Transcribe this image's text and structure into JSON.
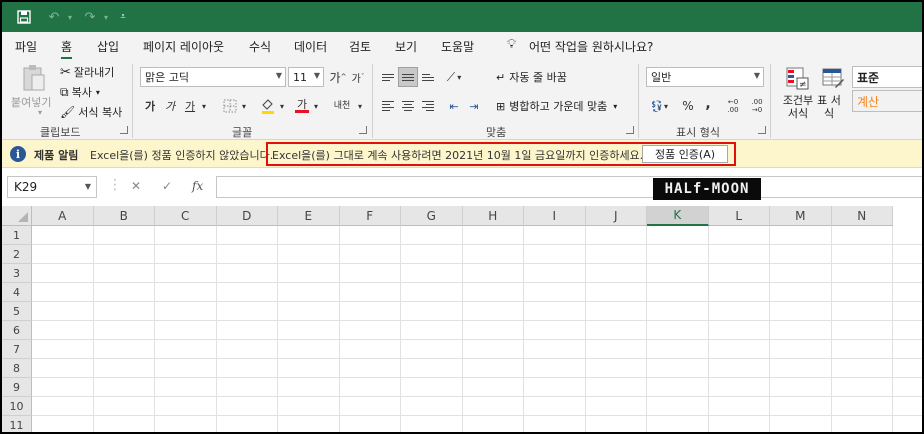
{
  "quick_access": {
    "save_icon": "save-icon",
    "undo_icon": "undo-icon",
    "redo_icon": "redo-icon",
    "customize_icon": "customize-icon"
  },
  "menu": {
    "tabs": [
      "파일",
      "홈",
      "삽입",
      "페이지 레이아웃",
      "수식",
      "데이터",
      "검토",
      "보기",
      "도움말"
    ],
    "active_tab": "홈",
    "search_label": "어떤 작업을 원하시나요?"
  },
  "ribbon": {
    "clipboard": {
      "paste": "붙여넣기",
      "cut": "잘라내기",
      "copy": "복사",
      "format_painter": "서식 복사",
      "group_label": "클립보드"
    },
    "font": {
      "font_name": "맑은 고딕",
      "font_size": "11",
      "grow": "가",
      "shrink": "가",
      "bold": "가",
      "italic": "가",
      "underline": "가",
      "font_color_glyph": "가",
      "phonetic": "내천",
      "group_label": "글꼴"
    },
    "alignment": {
      "wrap_text": "자동 줄 바꿈",
      "merge_center": "병합하고 가운데 맞춤",
      "group_label": "맞춤"
    },
    "number": {
      "format": "일반",
      "percent": "%",
      "comma": ",",
      "increase_decimal": "←0 .00",
      "decrease_decimal": ".00 →0",
      "group_label": "표시 형식"
    },
    "styles": {
      "conditional_format": "조건부 서식",
      "format_as_table": "표 서식",
      "style_normal": "표준",
      "style_calc": "계산"
    }
  },
  "notification": {
    "title": "제품 알림",
    "message_part1": "Excel을(를) 정품 인증하지 않았습니다.",
    "message_part2": "Excel을(를) 그대로 계속 사용하려면 2021년 10월 1일 금요일까지 인증하세요.",
    "button": "정품 인증(A)"
  },
  "formula_bar": {
    "name_box": "K29",
    "cancel": "✕",
    "enter": "✓",
    "fx": "fx",
    "value": ""
  },
  "watermark": "HALf-MOON",
  "sheet": {
    "columns": [
      "A",
      "B",
      "C",
      "D",
      "E",
      "F",
      "G",
      "H",
      "I",
      "J",
      "K",
      "L",
      "M",
      "N"
    ],
    "selected_column": "K",
    "rows": [
      "1",
      "2",
      "3",
      "4",
      "5",
      "6",
      "7",
      "8",
      "9",
      "10",
      "11"
    ]
  },
  "colors": {
    "title_bar": "#217346",
    "notice_bg": "#fdf6cc",
    "highlight_box": "#e01010",
    "calc_style": "#f7831f"
  }
}
